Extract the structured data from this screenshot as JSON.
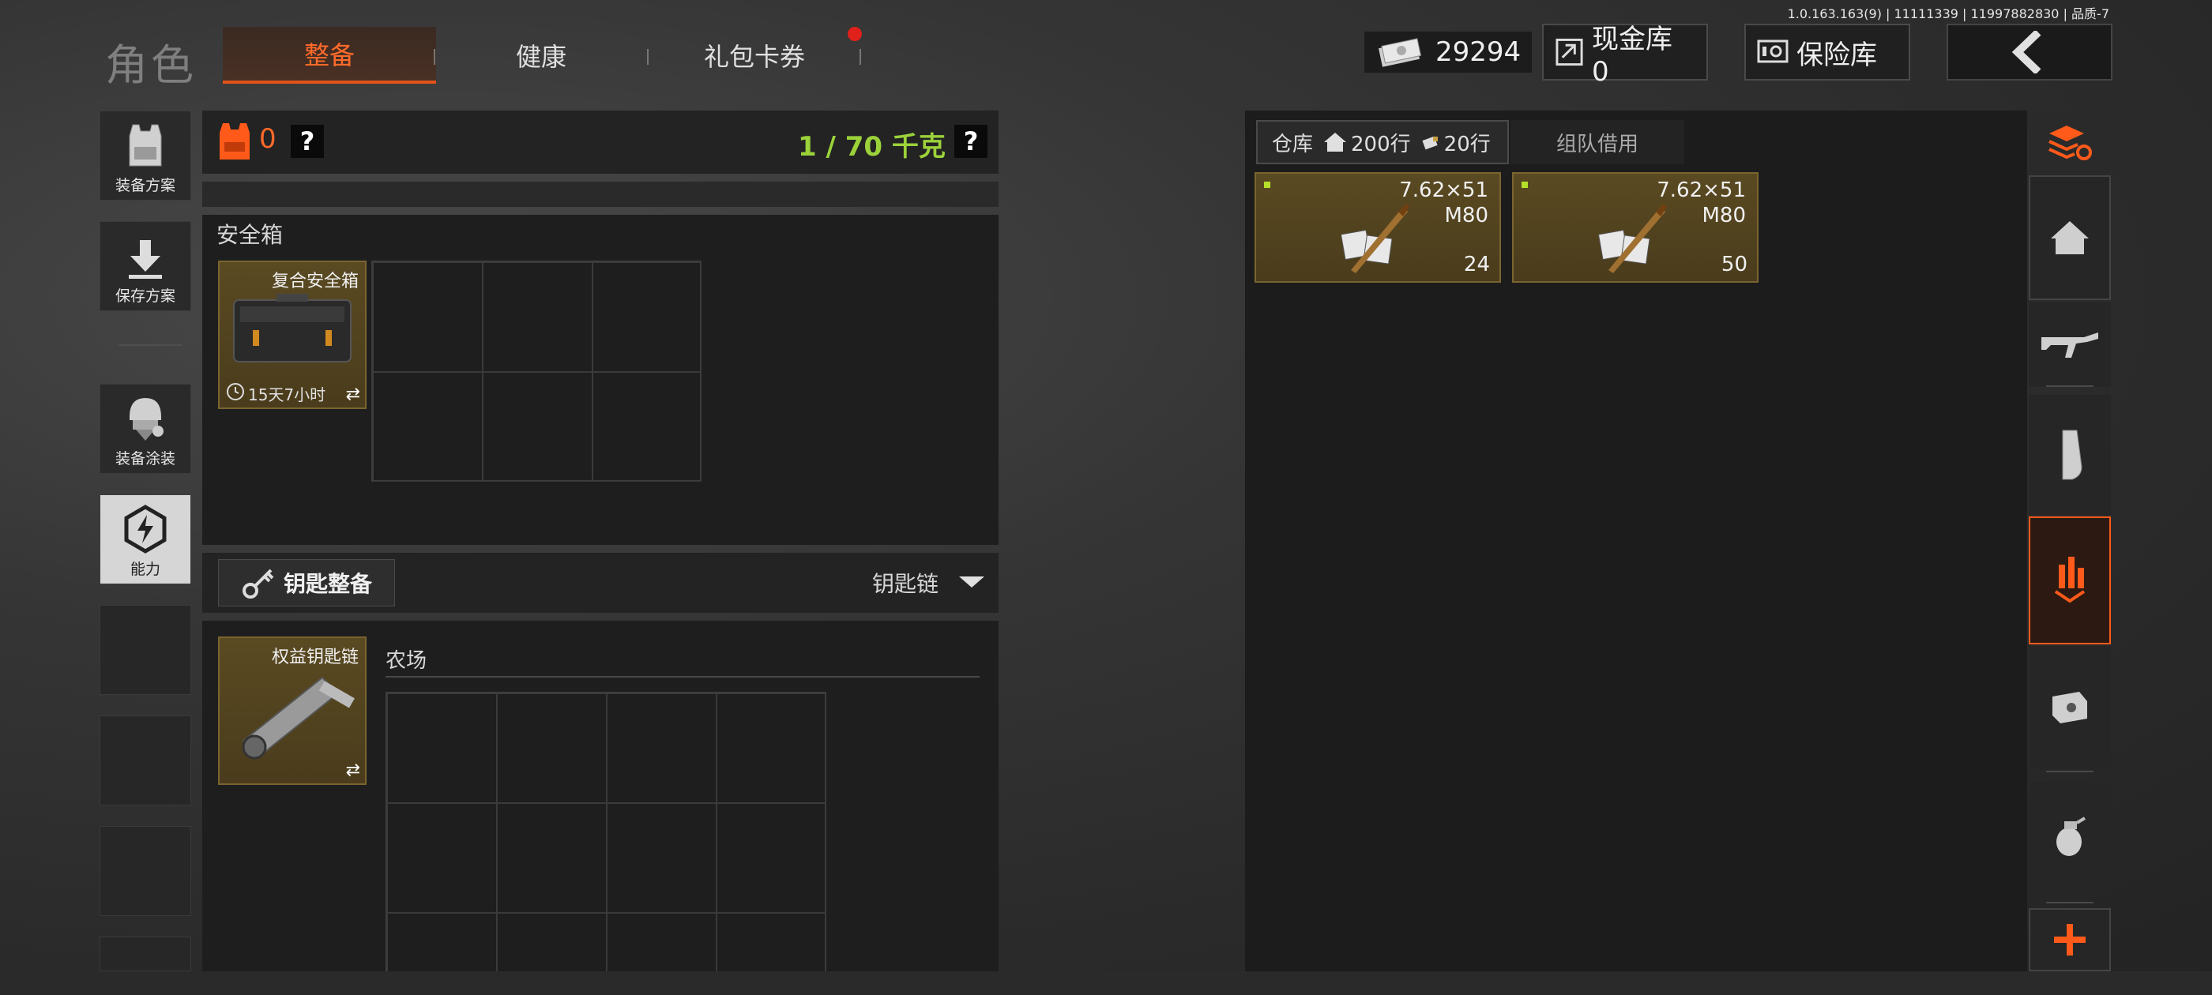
{
  "version": "1.0.163.163(9) | 11111339 | 11997882830 | 品质-7",
  "header": {
    "title": "角色",
    "tabs": [
      {
        "label": "整备",
        "active": true
      },
      {
        "label": "健康",
        "active": false
      },
      {
        "label": "礼包卡券",
        "active": false,
        "badge": true
      }
    ],
    "currency": "29294",
    "cash_vault": "现金库 0",
    "insurance_vault": "保险库"
  },
  "left_rail": {
    "items": [
      {
        "label": "装备方案",
        "icon": "vest-icon"
      },
      {
        "label": "保存方案",
        "icon": "download-icon"
      },
      {
        "label": "装备涂装",
        "icon": "helmet-icon"
      },
      {
        "label": "能力",
        "icon": "ability-icon"
      }
    ]
  },
  "loadout": {
    "armor_count": "0",
    "weight": "1 / 70 千克",
    "help": "?",
    "safebox_section": "安全箱",
    "safebox_item": "复合安全箱",
    "safebox_timer": "15天7小时",
    "key_button": "钥匙整备",
    "keychain_dropdown": "钥匙链",
    "keychain_item": "权益钥匙链",
    "farm_label": "农场"
  },
  "warehouse": {
    "tab_warehouse": "仓库",
    "rows_home": "200行",
    "rows_ammo": "20行",
    "tab_team": "组队借用",
    "items": [
      {
        "caliber": "7.62×51",
        "type": "M80",
        "count": "24"
      },
      {
        "caliber": "7.62×51",
        "type": "M80",
        "count": "50"
      }
    ]
  },
  "right_rail": {
    "icons": [
      "layers-refresh-icon",
      "home-icon",
      "rifle-icon",
      "magazine-icon",
      "ammo-sort-icon",
      "scope-icon",
      "grenade-icon",
      "plus-icon"
    ]
  },
  "colors": {
    "accent": "#ff6a2a",
    "weight": "#9bd23a",
    "gold": "#5a4a22"
  }
}
